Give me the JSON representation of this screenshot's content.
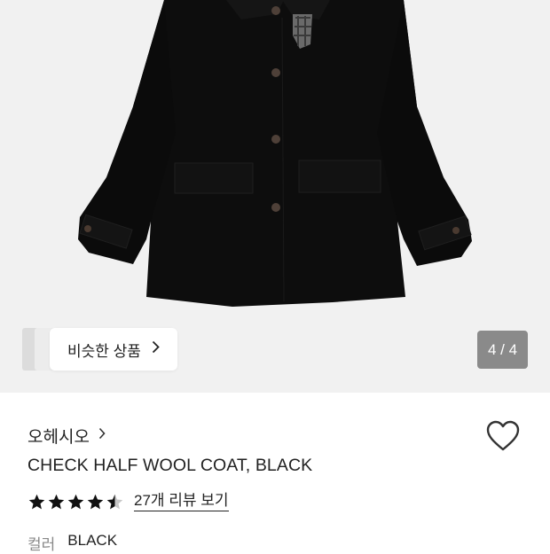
{
  "gallery": {
    "similar_label": "비슷한 상품",
    "counter": "4 / 4"
  },
  "product": {
    "brand": "오헤시오",
    "title": "CHECK HALF WOOL COAT, BLACK",
    "rating": 4.5,
    "reviews_link": "27개 리뷰 보기",
    "color_label": "컬러",
    "color_value": "BLACK"
  },
  "icons": {
    "similar_chevron": "chevron-right-icon",
    "brand_chevron": "chevron-right-icon",
    "wishlist": "heart-outline-icon",
    "star": "star-icon"
  }
}
